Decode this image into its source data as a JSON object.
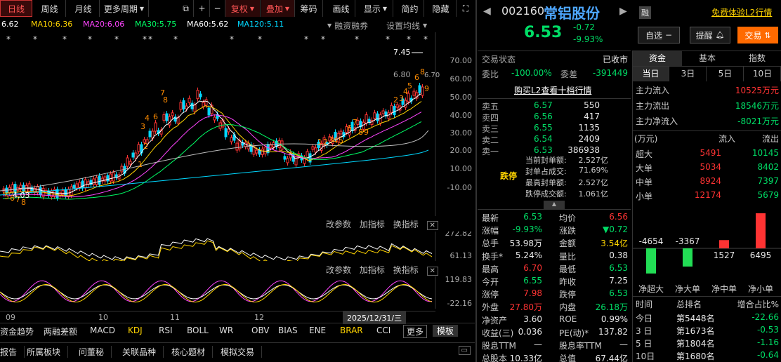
{
  "periods": [
    "日线",
    "周线",
    "月线",
    "更多周期"
  ],
  "toolbar": {
    "restore": "复权",
    "overlay": "叠加",
    "chips": "筹码",
    "draw": "画线",
    "display": "显示",
    "simplify": "简约",
    "hide": "隐藏"
  },
  "ma": [
    {
      "label": "6.62",
      "color": "#ffffff"
    },
    {
      "label": "MA10:6.36",
      "color": "#ffd400"
    },
    {
      "label": "MA20:6.06",
      "color": "#ff44ff"
    },
    {
      "label": "MA30:5.75",
      "color": "#00ff66"
    },
    {
      "label": "MA60:5.62",
      "color": "#ffffff"
    },
    {
      "label": "MA120:5.11",
      "color": "#00d8ff"
    }
  ],
  "ma_links": {
    "margin": "融资融券",
    "setma": "设置均线"
  },
  "axis_main": [
    "70.00",
    "60.00",
    "50.00",
    "40.00",
    "30.00",
    "20.00",
    "10.00",
    "-10.00"
  ],
  "price_marks": {
    "high": "7.45",
    "mid": "6.80",
    "low": "4.03",
    "right": "6.70"
  },
  "buttons_ind": {
    "params": "改参数",
    "add": "加指标",
    "swap": "换指标"
  },
  "axis_ind1": [
    "272.82",
    "61.13"
  ],
  "axis_ind2": [
    "119.83",
    "-22.16"
  ],
  "months": [
    "09",
    "10",
    "11",
    "12"
  ],
  "date_tag": "2025/12/31/三",
  "tabs_bottom": [
    "资金趋势",
    "两融差额",
    "MACD",
    "KDJ",
    "RSI",
    "BOLL",
    "WR",
    "OBV",
    "BIAS",
    "ENE",
    "BRAR",
    "CCI"
  ],
  "tab_more": "更多",
  "tab_template": "模板",
  "tabs_footer": [
    "报告",
    "所属板块",
    "问董秘",
    "关联品种",
    "核心题材",
    "模拟交易"
  ],
  "stock": {
    "code": "002160",
    "name": "常铝股份",
    "tag": "融",
    "price": "6.53",
    "change": "-0.72",
    "pct": "-9.93%",
    "promo": "免费体验L2行情"
  },
  "actions": {
    "watch": "自选",
    "remind": "提醒",
    "trade": "交易"
  },
  "status": {
    "label": "交易状态",
    "value": "已收市",
    "wb_label": "委比",
    "wb_value": "-100.00%",
    "wc_label": "委差",
    "wc_value": "-391449",
    "l2": "购买L2查看十档行情"
  },
  "asks": [
    {
      "l": "卖五",
      "p": "6.57",
      "v": "550"
    },
    {
      "l": "卖四",
      "p": "6.56",
      "v": "417"
    },
    {
      "l": "卖三",
      "p": "6.55",
      "v": "1135"
    },
    {
      "l": "卖二",
      "p": "6.54",
      "v": "2409"
    },
    {
      "l": "卖一",
      "p": "6.53",
      "v": "386938"
    }
  ],
  "limit": {
    "tag": "跌停",
    "rows": [
      {
        "l": "当前封单额:",
        "v": "2.527亿"
      },
      {
        "l": "封单占成交:",
        "v": "71.69%"
      },
      {
        "l": "最高封单额:",
        "v": "2.527亿"
      },
      {
        "l": "跌停成交额:",
        "v": "1.061亿"
      }
    ]
  },
  "quote": [
    {
      "a": "最新",
      "av": "6.53",
      "ac": "grn",
      "b": "均价",
      "bv": "6.56",
      "bc": "red"
    },
    {
      "a": "涨幅",
      "av": "-9.93%",
      "ac": "grn",
      "b": "涨跌",
      "bv": "▼0.72",
      "bc": "grn"
    },
    {
      "a": "总手",
      "av": "53.98万",
      "ac": "wht",
      "b": "金额",
      "bv": "3.54亿",
      "bc": "yel"
    },
    {
      "a": "换手*",
      "av": "5.24%",
      "ac": "wht",
      "b": "量比",
      "bv": "0.38",
      "bc": "wht"
    },
    {
      "a": "最高",
      "av": "6.70",
      "ac": "red",
      "b": "最低",
      "bv": "6.53",
      "bc": "grn"
    },
    {
      "a": "今开",
      "av": "6.55",
      "ac": "grn",
      "b": "昨收",
      "bv": "7.25",
      "bc": "wht"
    },
    {
      "a": "涨停",
      "av": "7.98",
      "ac": "red",
      "b": "跌停",
      "bv": "6.53",
      "bc": "grn"
    },
    {
      "a": "外盘",
      "av": "27.80万",
      "ac": "red",
      "b": "内盘",
      "bv": "26.18万",
      "bc": "grn"
    },
    {
      "a": "净资产",
      "av": "3.60",
      "ac": "wht",
      "b": "ROE",
      "bv": "0.99%",
      "bc": "wht"
    },
    {
      "a": "收益(三)",
      "av": "0.036",
      "ac": "wht",
      "b": "PE(动)*",
      "bv": "137.82",
      "bc": "wht"
    },
    {
      "a": "股息TTM",
      "av": "—",
      "ac": "wht",
      "b": "股息率TTM",
      "bv": "—",
      "bc": "wht"
    },
    {
      "a": "总股本",
      "av": "10.33亿",
      "ac": "wht",
      "b": "总值",
      "bv": "67.44亿",
      "bc": "wht"
    }
  ],
  "fund_tabs": [
    "资金",
    "基本",
    "指数"
  ],
  "day_tabs": [
    "当日",
    "3日",
    "5日",
    "10日"
  ],
  "flow": [
    {
      "l": "主力流入",
      "v": "10525万元",
      "c": "red"
    },
    {
      "l": "主力流出",
      "v": "18546万元",
      "c": "grn"
    },
    {
      "l": "主力净流入",
      "v": "-8021万元",
      "c": "grn"
    }
  ],
  "flow_head": {
    "unit": "(万元)",
    "in": "流入",
    "out": "流出"
  },
  "flow_rows": [
    {
      "l": "超大",
      "i": "5491",
      "o": "10145"
    },
    {
      "l": "大单",
      "i": "5034",
      "o": "8402"
    },
    {
      "l": "中单",
      "i": "8924",
      "o": "7397"
    },
    {
      "l": "小单",
      "i": "12174",
      "o": "5679"
    }
  ],
  "net_bars": [
    {
      "l": "净超大",
      "v": "-4654",
      "n": -4654
    },
    {
      "l": "净大单",
      "v": "-3367",
      "n": -3367
    },
    {
      "l": "净中单",
      "v": "1527",
      "n": 1527
    },
    {
      "l": "净小单",
      "v": "6495",
      "n": 6495
    }
  ],
  "rank_head": {
    "t": "时间",
    "r": "总排名",
    "c": "增合占比%"
  },
  "ranks": [
    {
      "t": "今日",
      "r": "第5448名",
      "c": "-22.66"
    },
    {
      "t": "3 日",
      "r": "第1673名",
      "c": "-0.53"
    },
    {
      "t": "5 日",
      "r": "第1804名",
      "c": "-1.16"
    },
    {
      "t": "10日",
      "r": "第1680名",
      "c": "-0.64"
    }
  ],
  "colors": {
    "up": "#ff3333",
    "down": "#00dd66",
    "accent": "#ff6a00"
  }
}
